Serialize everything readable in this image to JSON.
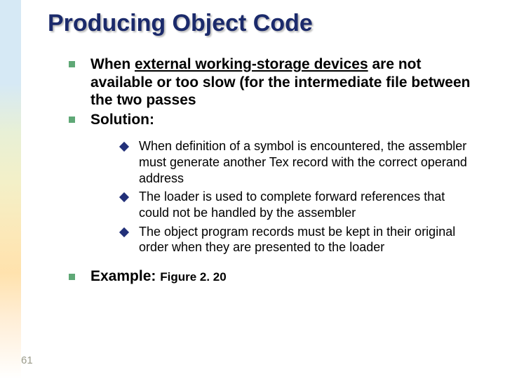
{
  "title": "Producing Object Code",
  "bullets": {
    "b1_pre": "When ",
    "b1_underlined": "external working-storage devices",
    "b1_post": " are not available or too slow (for the intermediate file between the two passes",
    "b2": "Solution:",
    "sub1": "When definition of a symbol is encountered, the assembler must generate another Tex record with the correct operand address",
    "sub2": "The loader is used to complete forward references that could not be handled by the assembler",
    "sub3": "The object program records must be kept in their original order when they are presented to the loader",
    "b3_label": "Example: ",
    "b3_ref": "Figure 2. 20"
  },
  "page_number": "61"
}
